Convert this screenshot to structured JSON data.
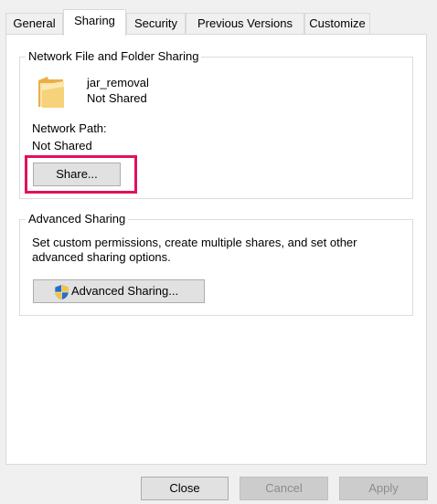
{
  "tabs": [
    {
      "label": "General"
    },
    {
      "label": "Sharing"
    },
    {
      "label": "Security"
    },
    {
      "label": "Previous Versions"
    },
    {
      "label": "Customize"
    }
  ],
  "network_sharing": {
    "title": "Network File and Folder Sharing",
    "folder_name": "jar_removal",
    "status": "Not Shared",
    "network_path_label": "Network Path:",
    "network_path_value": "Not Shared",
    "share_button": "Share..."
  },
  "advanced_sharing": {
    "title": "Advanced Sharing",
    "description_line1": "Set custom permissions, create multiple shares, and set other",
    "description_line2": "advanced sharing options.",
    "button": "Advanced Sharing..."
  },
  "footer": {
    "close": "Close",
    "cancel": "Cancel",
    "apply": "Apply"
  },
  "colors": {
    "highlight": "#e0115f",
    "folder": "#f4c96b",
    "shield_blue": "#2a6ec4",
    "shield_yellow": "#f5c542"
  },
  "icons": {
    "folder": "folder-icon",
    "shield": "uac-shield-icon"
  }
}
